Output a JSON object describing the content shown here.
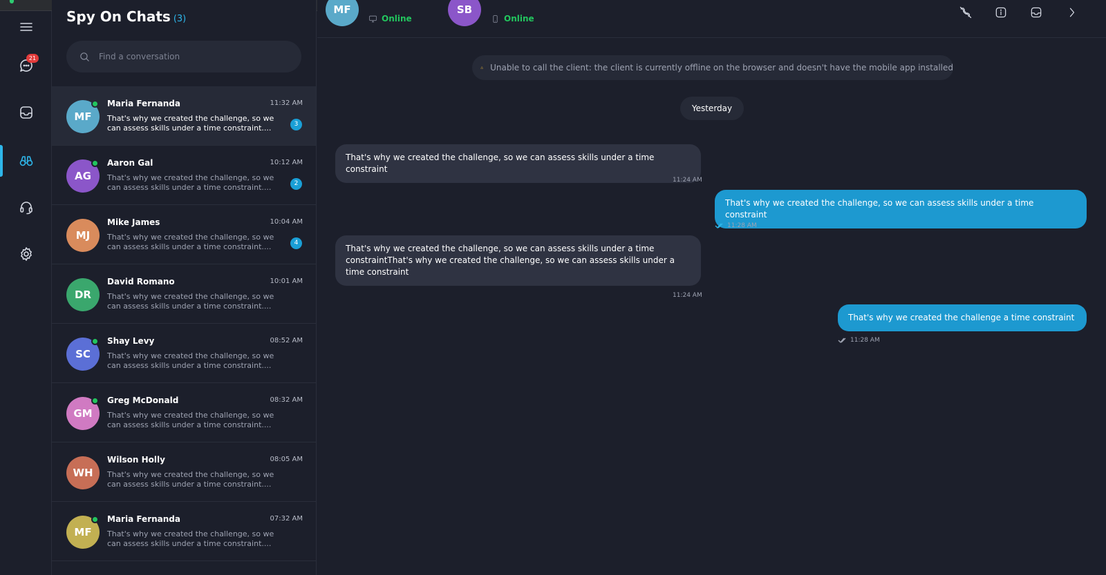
{
  "colors": {
    "accent": "#2eb6ea",
    "online": "#22c55e",
    "badge": "#e23b3b",
    "outgoing_bubble": "#1d99d0",
    "warning": "#e8b63a"
  },
  "rail": {
    "items": [
      {
        "icon": "chat-bubble-icon",
        "badge": "21"
      },
      {
        "icon": "inbox-icon"
      },
      {
        "icon": "binoculars-icon",
        "active": true
      },
      {
        "icon": "headset-icon"
      },
      {
        "icon": "gear-icon"
      }
    ]
  },
  "list": {
    "title": "Spy On Chats",
    "count": "(3)",
    "search_placeholder": "Find a conversation",
    "conversations": [
      {
        "initials": "MF",
        "name": "Maria Fernanda",
        "time": "11:32 AM",
        "preview": "That's why we created the challenge, so we can assess skills under a time constraint....",
        "unread": "3",
        "online": true,
        "color": "#5aa9c9",
        "active": true
      },
      {
        "initials": "AG",
        "name": "Aaron Gal",
        "time": "10:12 AM",
        "preview": "That's why we created the challenge, so we can assess skills under a time constraint....",
        "unread": "2",
        "online": true,
        "color": "#8b56c9"
      },
      {
        "initials": "MJ",
        "name": "Mike James",
        "time": "10:04 AM",
        "preview": "That's why we created the challenge, so we can assess skills under a time constraint....",
        "unread": "4",
        "online": false,
        "color": "#d98b5c"
      },
      {
        "initials": "DR",
        "name": "David Romano",
        "time": "10:01 AM",
        "preview": "That's why we created the challenge, so we can assess skills under a time constraint....",
        "online": false,
        "color": "#3aa76d"
      },
      {
        "initials": "SC",
        "name": "Shay Levy",
        "time": "08:52 AM",
        "preview": "That's why we created the challenge, so we can assess skills under a time constraint....",
        "online": true,
        "color": "#5b6fd6"
      },
      {
        "initials": "GM",
        "name": "Greg McDonald",
        "time": "08:32 AM",
        "preview": "That's why we created the challenge, so we can assess skills under a time constraint....",
        "online": true,
        "color": "#d07ac2"
      },
      {
        "initials": "WH",
        "name": "Wilson Holly",
        "time": "08:05 AM",
        "preview": "That's why we created the challenge, so we can assess skills under a time constraint....",
        "online": false,
        "color": "#c76e56"
      },
      {
        "initials": "MF",
        "name": "Maria Fernanda",
        "time": "07:32 AM",
        "preview": "That's why we created the challenge, so we can assess skills under a time constraint....",
        "online": true,
        "color": "#c2b052"
      }
    ]
  },
  "chat": {
    "participants": [
      {
        "initials": "MF",
        "status": "Online",
        "device_icon": "desktop-icon",
        "color": "#5aa9c9"
      },
      {
        "initials": "SB",
        "status": "Online",
        "device_icon": "mobile-icon",
        "color": "#8b56c9"
      }
    ],
    "header_actions": [
      "phone-off-icon",
      "info-icon",
      "inbox-icon",
      "chevron-right-icon"
    ],
    "warning": "Unable to call the client: the client is currently offline on the browser and doesn't have the mobile app installed",
    "day_separator": "Yesterday",
    "messages": [
      {
        "direction": "in",
        "text": "That's why we created the challenge, so we can assess skills under a time constraint",
        "time": "11:24 AM"
      },
      {
        "direction": "out",
        "text": "That's why we created the challenge, so we can assess skills under a time constraint",
        "time": "11:28 AM",
        "read": true
      },
      {
        "direction": "in",
        "text": "That's why we created the challenge, so we can assess skills under a time constraintThat's why we created the challenge, so we can assess skills under a time constraint",
        "time": "11:24 AM"
      },
      {
        "direction": "out",
        "text": "That's why we created the challenge a time constraint",
        "time": "11:28 AM",
        "read": false
      }
    ]
  }
}
